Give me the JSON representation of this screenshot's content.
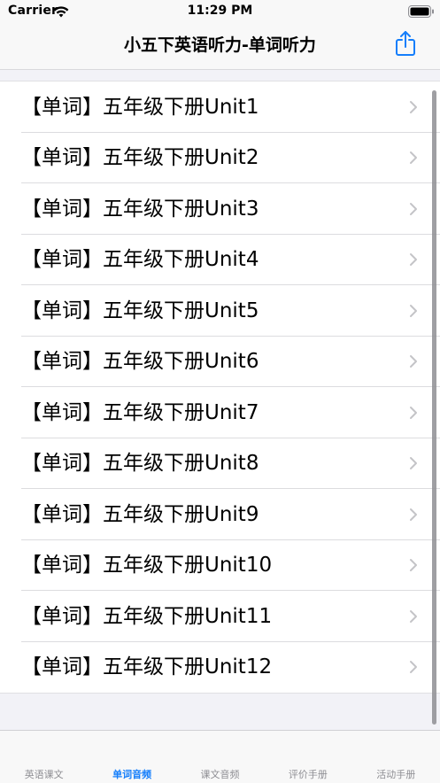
{
  "status_bar": {
    "carrier": "Carrier",
    "time": "11:29 PM",
    "icons": [
      "wifi-icon",
      "battery-icon"
    ]
  },
  "nav": {
    "title": "小五下英语听力-单词听力",
    "share_icon": "share-icon"
  },
  "list": {
    "items": [
      {
        "label": "【单词】五年级下册Unit1"
      },
      {
        "label": "【单词】五年级下册Unit2"
      },
      {
        "label": "【单词】五年级下册Unit3"
      },
      {
        "label": "【单词】五年级下册Unit4"
      },
      {
        "label": "【单词】五年级下册Unit5"
      },
      {
        "label": "【单词】五年级下册Unit6"
      },
      {
        "label": "【单词】五年级下册Unit7"
      },
      {
        "label": "【单词】五年级下册Unit8"
      },
      {
        "label": "【单词】五年级下册Unit9"
      },
      {
        "label": "【单词】五年级下册Unit10"
      },
      {
        "label": "【单词】五年级下册Unit11"
      },
      {
        "label": "【单词】五年级下册Unit12"
      }
    ]
  },
  "tabs": {
    "items": [
      {
        "label": "英语课文",
        "active": false
      },
      {
        "label": "单词音频",
        "active": true
      },
      {
        "label": "课文音频",
        "active": false
      },
      {
        "label": "评价手册",
        "active": false
      },
      {
        "label": "活动手册",
        "active": false
      }
    ]
  },
  "colors": {
    "accent": "#147efb",
    "inactive_tab": "#8e8e93",
    "background": "#f2f2f7",
    "chevron": "#c4c4c7"
  }
}
